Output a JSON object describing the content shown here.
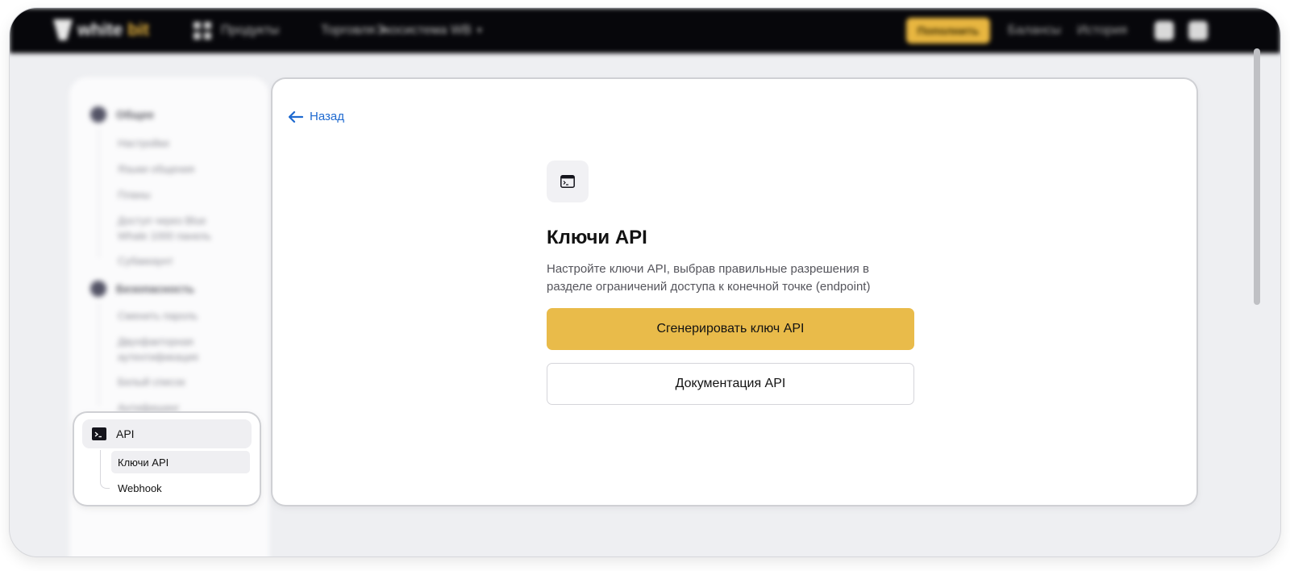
{
  "topbar": {
    "logo_part1": "white",
    "logo_part2": "bit",
    "nav": [
      "Продукты",
      "Торговля",
      "Экосистема WB"
    ],
    "deposit_label": "Пополнить",
    "links": [
      "Балансы",
      "История"
    ]
  },
  "sidebar": {
    "sections": [
      {
        "label": "Общее",
        "items": [
          "Настройки",
          "Языки общения",
          "Планы",
          "Доступ через Blue Whale 1000 панель",
          "Субаккаунт"
        ]
      },
      {
        "label": "Безопасность",
        "items": [
          "Сменить пароль",
          "Двухфакторная аутентификация",
          "Белый список",
          "Антифишинг"
        ]
      }
    ],
    "api": {
      "label": "API",
      "items": [
        "Ключи API",
        "Webhook"
      ]
    }
  },
  "main": {
    "back_label": "Назад",
    "title": "Ключи API",
    "description": "Настройте ключи API, выбрав правильные разрешения в разделе ограничений доступа к конечной точке (endpoint)",
    "primary_button": "Сгенерировать ключ API",
    "secondary_button": "Документация API"
  },
  "colors": {
    "accent": "#e9bb4a",
    "link": "#1f6ad0",
    "topbar": "#07070b"
  }
}
